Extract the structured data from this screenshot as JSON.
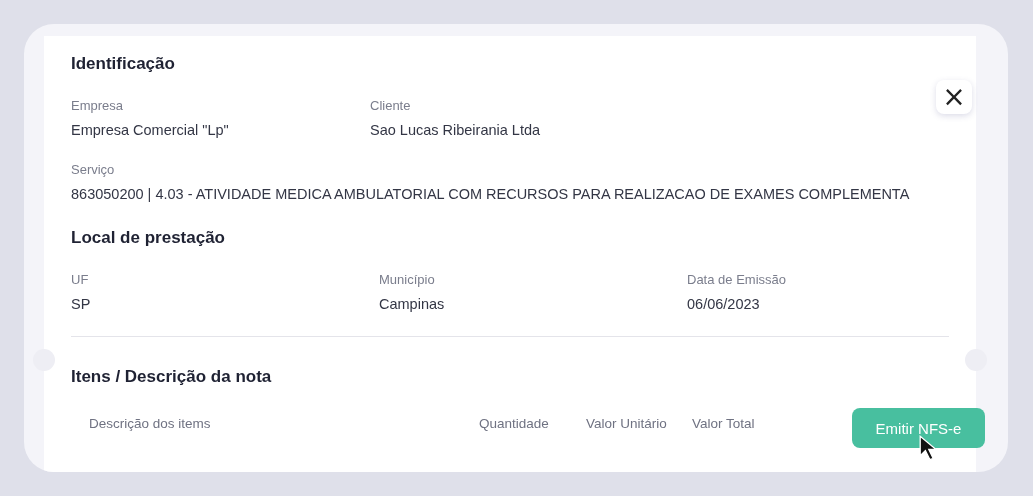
{
  "sections": [
    {
      "title": "Identificação",
      "rows": [
        {
          "fields": [
            {
              "label": "Empresa",
              "value": "Empresa Comercial \"Lp\""
            },
            {
              "label": "Cliente",
              "value": "Sao Lucas Ribeirania Ltda"
            }
          ]
        },
        {
          "fields": [
            {
              "label": "Serviço",
              "value": "863050200 | 4.03 - ATIVIDADE MEDICA AMBULATORIAL COM RECURSOS PARA REALIZACAO DE EXAMES COMPLEMENTA"
            }
          ]
        }
      ]
    },
    {
      "title": "Local de prestação",
      "rows": [
        {
          "fields": [
            {
              "label": "UF",
              "value": "SP"
            },
            {
              "label": "Município",
              "value": "Campinas"
            },
            {
              "label": "Data de Emissão",
              "value": "06/06/2023"
            }
          ]
        }
      ]
    }
  ],
  "items": {
    "title": "Itens / Descrição da nota",
    "columns": [
      "Descrição dos items",
      "Quantidade",
      "Valor Unitário",
      "Valor Total"
    ]
  },
  "emit_button": {
    "label": "Emitir NFS-e"
  },
  "close_button": {
    "label": "×"
  }
}
